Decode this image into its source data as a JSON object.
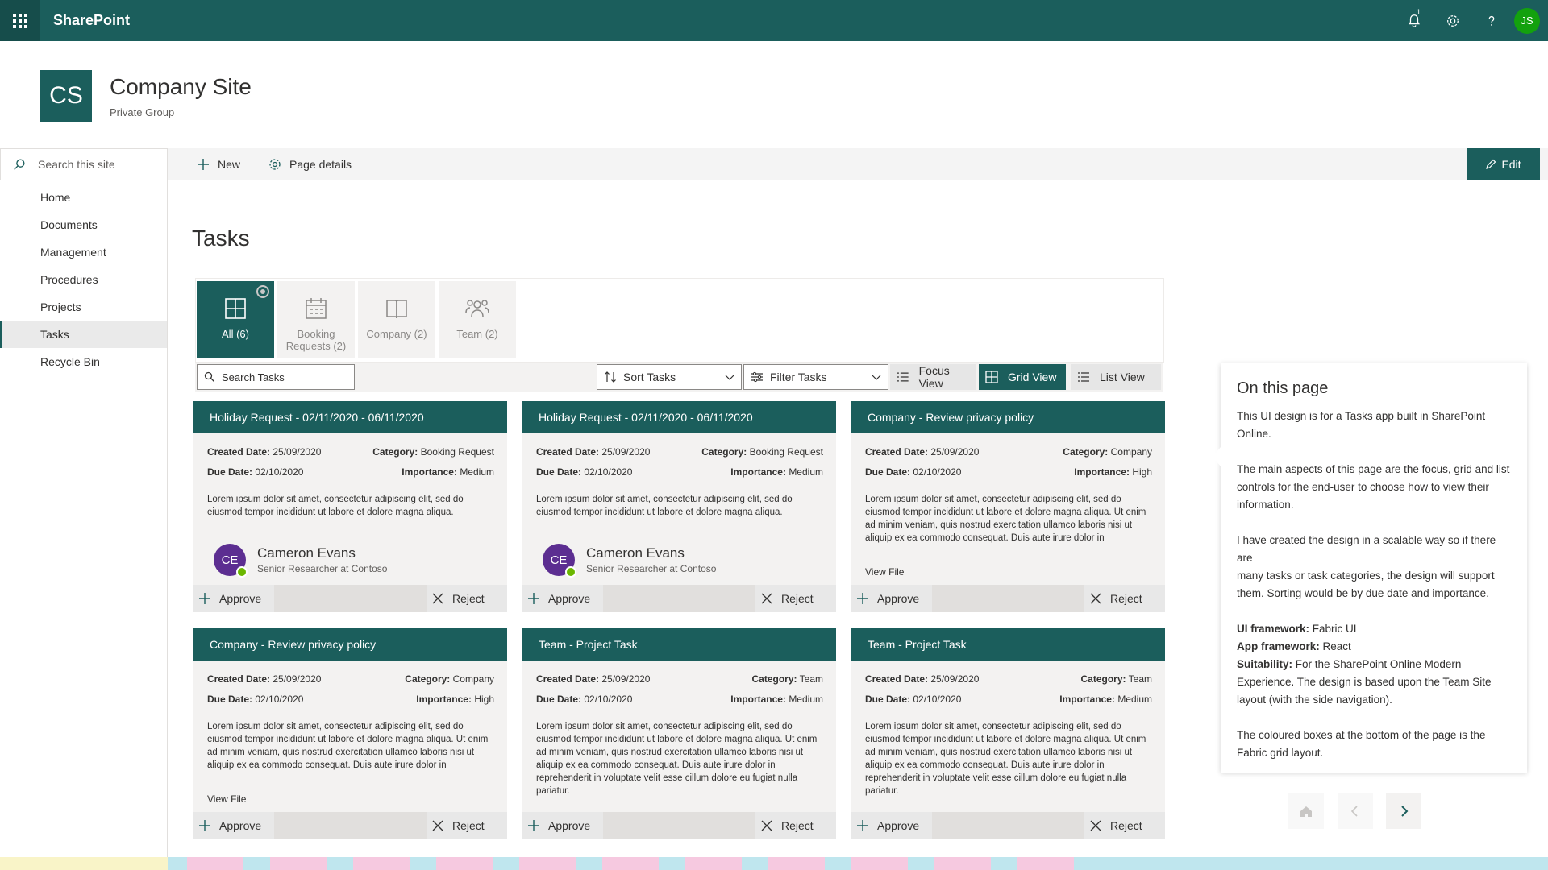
{
  "suite": {
    "brand": "SharePoint",
    "notification_count": "1",
    "user_initials": "JS"
  },
  "site": {
    "logo": "CS",
    "title": "Company Site",
    "subtitle": "Private Group"
  },
  "commandbar": {
    "search_placeholder": "Search this site",
    "new_label": "New",
    "page_details_label": "Page details",
    "edit_label": "Edit"
  },
  "nav": {
    "items": [
      {
        "label": "Home"
      },
      {
        "label": "Documents"
      },
      {
        "label": "Management"
      },
      {
        "label": "Procedures"
      },
      {
        "label": "Projects"
      },
      {
        "label": "Tasks",
        "active": true
      },
      {
        "label": "Recycle Bin"
      }
    ]
  },
  "page": {
    "title": "Tasks"
  },
  "categories": [
    {
      "line1": "All (6)",
      "line2": "",
      "icon": "grid-icon",
      "active": true
    },
    {
      "line1": "Booking",
      "line2": "Requests (2)",
      "icon": "calendar-icon"
    },
    {
      "line1": "Company (2)",
      "line2": "",
      "icon": "book-icon"
    },
    {
      "line1": "Team (2)",
      "line2": "",
      "icon": "people-icon"
    }
  ],
  "toolbar": {
    "search_placeholder": "Search Tasks",
    "sort_label": "Sort Tasks",
    "filter_label": "Filter Tasks",
    "focus_view": "Focus View",
    "grid_view": "Grid View",
    "list_view": "List View"
  },
  "labels": {
    "created": "Created Date:",
    "due": "Due Date:",
    "category": "Category:",
    "importance": "Importance:",
    "approve": "Approve",
    "reject": "Reject",
    "view_file": "View File"
  },
  "cards": [
    {
      "title": "Holiday Request - 02/11/2020 - 06/11/2020",
      "created": "25/09/2020",
      "due": "02/10/2020",
      "category": "Booking Request",
      "importance": "Medium",
      "desc": [
        "Lorem ipsum dolor sit amet, consectetur adipiscing elit, sed do",
        "eiusmod tempor incididunt ut labore et dolore magna aliqua."
      ],
      "person": {
        "initials": "CE",
        "name": "Cameron Evans",
        "role": "Senior Researcher at Contoso"
      }
    },
    {
      "title": "Holiday Request - 02/11/2020 - 06/11/2020",
      "created": "25/09/2020",
      "due": "02/10/2020",
      "category": "Booking Request",
      "importance": "Medium",
      "desc": [
        "Lorem ipsum dolor sit amet, consectetur adipiscing elit, sed do",
        "eiusmod tempor incididunt ut labore et dolore magna aliqua."
      ],
      "person": {
        "initials": "CE",
        "name": "Cameron Evans",
        "role": "Senior Researcher at Contoso"
      }
    },
    {
      "title": "Company - Review privacy policy",
      "created": "25/09/2020",
      "due": "02/10/2020",
      "category": "Company",
      "importance": "High",
      "desc": [
        "Lorem ipsum dolor sit amet, consectetur adipiscing elit, sed do",
        "eiusmod tempor incididunt ut labore et dolore magna aliqua. Ut enim",
        "ad minim veniam, quis nostrud exercitation ullamco laboris nisi ut",
        "aliquip ex ea commodo consequat. Duis aute irure dolor in"
      ]
    },
    {
      "title": "Company - Review privacy policy",
      "created": "25/09/2020",
      "due": "02/10/2020",
      "category": "Company",
      "importance": "High",
      "desc": [
        "Lorem ipsum dolor sit amet, consectetur adipiscing elit, sed do",
        "eiusmod tempor incididunt ut labore et dolore magna aliqua. Ut enim",
        "ad minim veniam, quis nostrud exercitation ullamco laboris nisi ut",
        "aliquip ex ea commodo consequat. Duis aute irure dolor in"
      ]
    },
    {
      "title": "Team - Project Task",
      "created": "25/09/2020",
      "due": "02/10/2020",
      "category": "Team",
      "importance": "Medium",
      "desc": [
        "Lorem ipsum dolor sit amet, consectetur adipiscing elit, sed do",
        "eiusmod tempor incididunt ut labore et dolore magna aliqua. Ut enim",
        "ad minim veniam, quis nostrud exercitation ullamco laboris nisi ut",
        "aliquip ex ea commodo consequat. Duis aute irure dolor in",
        "reprehenderit in voluptate velit esse cillum dolore eu fugiat nulla",
        "pariatur."
      ]
    },
    {
      "title": "Team - Project Task",
      "created": "25/09/2020",
      "due": "02/10/2020",
      "category": "Team",
      "importance": "Medium",
      "desc": [
        "Lorem ipsum dolor sit amet, consectetur adipiscing elit, sed do",
        "eiusmod tempor incididunt ut labore et dolore magna aliqua. Ut enim",
        "ad minim veniam, quis nostrud exercitation ullamco laboris nisi ut",
        "aliquip ex ea commodo consequat. Duis aute irure dolor in",
        "reprehenderit in voluptate velit esse cillum dolore eu fugiat nulla",
        "pariatur."
      ]
    }
  ],
  "on_this_page": {
    "title": "On this page",
    "p1": [
      "This UI design is for a Tasks app built in SharePoint",
      "Online."
    ],
    "p2": [
      "The main aspects of this page are the focus, grid and list",
      "controls for the end-user to choose how to view their",
      "information."
    ],
    "p3": [
      "I have created the design in a scalable way so if there are",
      "many tasks or task categories, the design will support",
      "them. Sorting would be by due date and importance."
    ],
    "ui_framework_label": "UI framework:",
    "ui_framework": "Fabric UI",
    "app_framework_label": "App framework:",
    "app_framework": "React",
    "suitability_label": "Suitability:",
    "suitability": [
      "For the SharePoint Online Modern",
      "Experience. The design is based upon the Team Site",
      "layout (with the side navigation)."
    ],
    "p5": [
      "The coloured boxes at the bottom of the page is the",
      "Fabric grid layout."
    ]
  },
  "colors": {
    "brand": "#1b5e5c",
    "approve_presence": "#6bb700",
    "avatar": "#5c2e91",
    "strip_yellow": "#f9f4c8",
    "strip_pink": "#f6c9e0",
    "strip_blue": "#bfe6ee"
  }
}
